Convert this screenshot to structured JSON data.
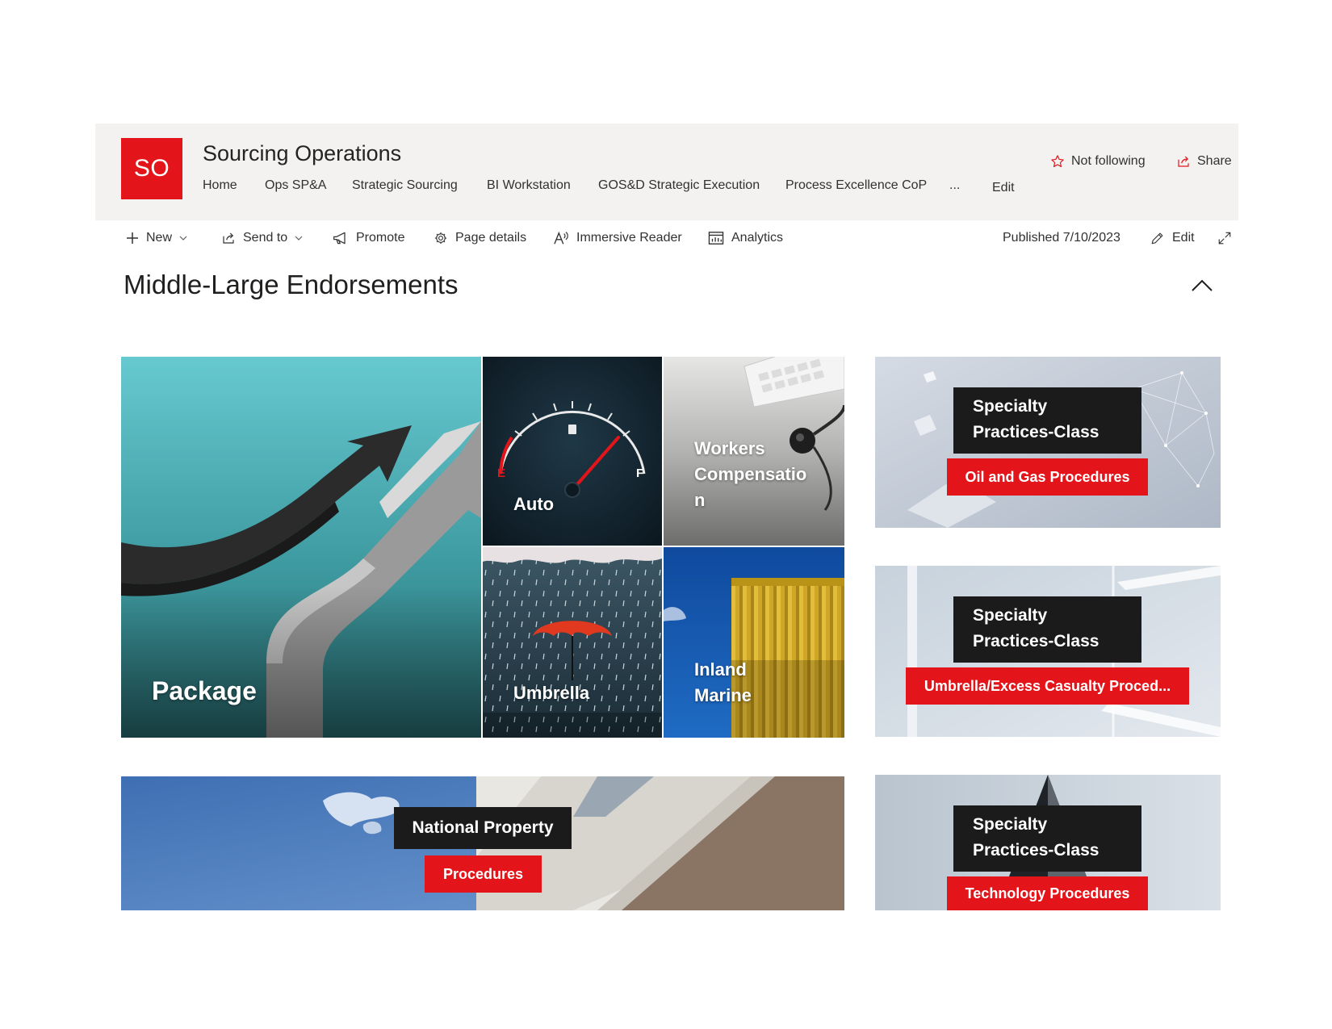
{
  "site": {
    "logo_text": "SO",
    "title": "Sourcing Operations",
    "nav": [
      "Home",
      "Ops SP&A",
      "Strategic Sourcing",
      "BI Workstation",
      "GOS&D Strategic Execution",
      "Process Excellence CoP"
    ],
    "nav_more": "...",
    "nav_edit": "Edit",
    "follow_label": "Not following",
    "share_label": "Share"
  },
  "commandbar": {
    "new": "New",
    "send_to": "Send to",
    "promote": "Promote",
    "page_details": "Page details",
    "immersive_reader": "Immersive Reader",
    "analytics": "Analytics",
    "published": "Published 7/10/2023",
    "edit": "Edit"
  },
  "page": {
    "title": "Middle-Large Endorsements"
  },
  "tiles": {
    "package": "Package",
    "auto": "Auto",
    "auto_gauge_empty": "E",
    "auto_gauge_full": "F",
    "workers_comp": [
      "Workers",
      "Compensatio",
      "n"
    ],
    "umbrella": "Umbrella",
    "inland_marine": [
      "Inland",
      "Marine"
    ]
  },
  "national_property": {
    "title": "National Property",
    "button": "Procedures"
  },
  "specialty": [
    {
      "title": [
        "Specialty",
        "Practices-Class"
      ],
      "button": "Oil and Gas Procedures"
    },
    {
      "title": [
        "Specialty",
        "Practices-Class"
      ],
      "button": "Umbrella/Excess Casualty Proced..."
    },
    {
      "title": [
        "Specialty",
        "Practices-Class"
      ],
      "button": "Technology Procedures"
    }
  ],
  "colors": {
    "brand_red": "#e3151a",
    "header_bg": "#f3f2f1",
    "label_box": "#1b1b1b"
  }
}
